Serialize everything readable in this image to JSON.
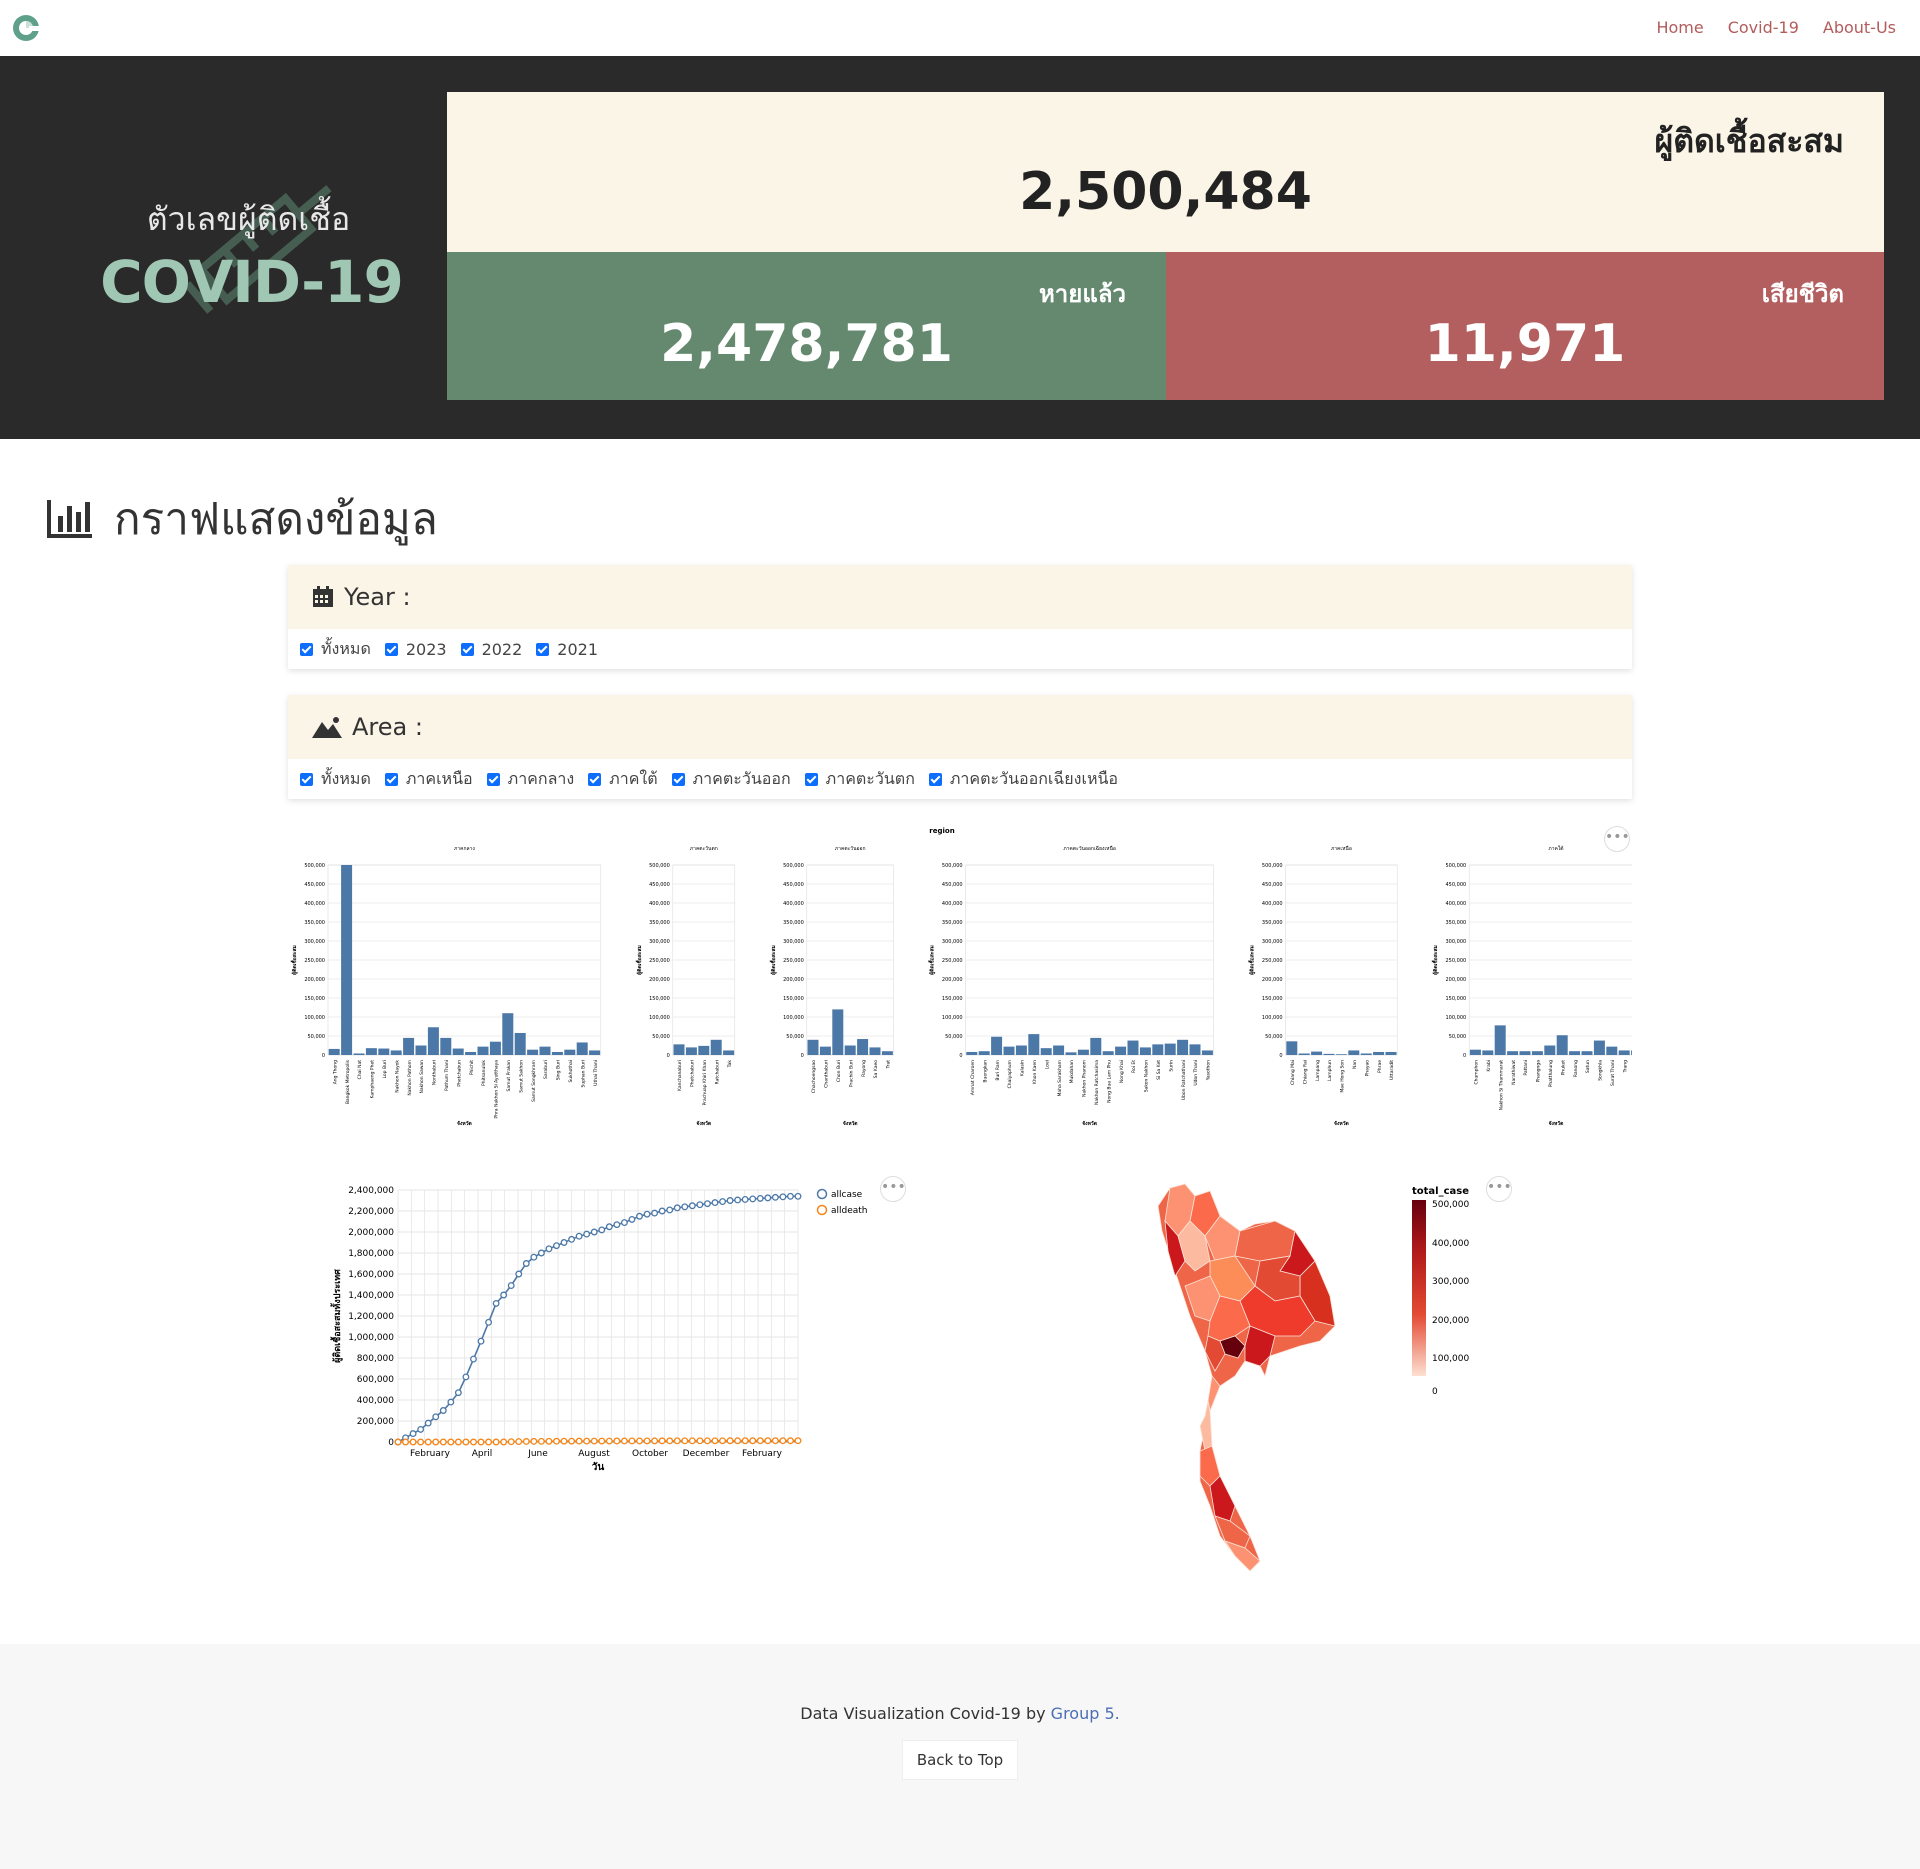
{
  "nav": {
    "links": [
      "Home",
      "Covid-19",
      "About-Us"
    ],
    "accent": "#b35c5c"
  },
  "hero": {
    "subtitle": "ตัวเลขผู้ติดเชื้อ",
    "title": "COVID-19",
    "total_label": "ผู้ติดเชื้อสะสม",
    "total_value": "2,500,484",
    "recovered_label": "หายแล้ว",
    "recovered_value": "2,478,781",
    "death_label": "เสียชีวิต",
    "death_value": "11,971",
    "colors": {
      "total_bg": "#fbf5e8",
      "recovered_bg": "#64896f",
      "death_bg": "#b35f60",
      "hero_bg": "#2a2a2a"
    }
  },
  "section": {
    "title": "กราฟแสดงข้อมูล"
  },
  "year_filter": {
    "label": "Year :",
    "options": [
      "ทั้งหมด",
      "2023",
      "2022",
      "2021"
    ]
  },
  "area_filter": {
    "label": "Area :",
    "options": [
      "ทั้งหมด",
      "ภาคเหนือ",
      "ภาคกลาง",
      "ภาคใต้",
      "ภาคตะวันออก",
      "ภาคตะวันตก",
      "ภาคตะวันออกเฉียงเหนือ"
    ]
  },
  "chart_data": [
    {
      "type": "bar",
      "title": "region",
      "ylabel": "ผู้ติดเชื้อสะสม",
      "xlabel": "จังหวัด",
      "ylim": [
        0,
        500000
      ],
      "yticks": [
        0,
        50000,
        100000,
        150000,
        200000,
        250000,
        300000,
        350000,
        400000,
        450000,
        500000
      ],
      "color": "#4c78a8",
      "facets": [
        {
          "name": "ภาคกลาง",
          "categories": [
            "Ang Thong",
            "Bangkok Metropolis",
            "Chai Nat",
            "Kamphaeng Phet",
            "Lop Buri",
            "Nakhon Nayok",
            "Nakhon Pathom",
            "Nakhon Sawan",
            "Nonthaburi",
            "Pathum Thani",
            "Phetchabun",
            "Phichit",
            "Phitsanulok",
            "Phra Nakhon Si Ayutthaya",
            "Samut Prakan",
            "Samut Sakhon",
            "Samut Songkhram",
            "Saraburi",
            "Sing Buri",
            "Sukhothai",
            "Suphan Buri",
            "Uthai Thani"
          ],
          "values": [
            16000,
            510000,
            4000,
            18000,
            17000,
            12000,
            45000,
            25000,
            73000,
            45000,
            17000,
            8000,
            22000,
            35000,
            110000,
            58000,
            14000,
            22000,
            8000,
            14000,
            33000,
            12000
          ]
        },
        {
          "name": "ภาคตะวันตก",
          "categories": [
            "Kanchanaburi",
            "Phetchaburi",
            "Prachuap Khiri Khan",
            "Ratchaburi",
            "Tak"
          ],
          "values": [
            28000,
            20000,
            24000,
            40000,
            12000
          ]
        },
        {
          "name": "ภาคตะวันออก",
          "categories": [
            "Chachoengsao",
            "Chanthaburi",
            "Chon Buri",
            "Prachin Buri",
            "Rayong",
            "Sa Kaeo",
            "Trat"
          ],
          "values": [
            40000,
            22000,
            120000,
            25000,
            42000,
            20000,
            10000
          ]
        },
        {
          "name": "ภาคตะวันออกเฉียงเหนือ",
          "categories": [
            "Amnat Charoen",
            "Buengkan",
            "Buri Ram",
            "Chaiyaphum",
            "Kalasin",
            "Khon Kaen",
            "Loei",
            "Maha Sarakham",
            "Mukdahan",
            "Nakhon Phanom",
            "Nakhon Ratchasima",
            "Nong Bua Lam Phu",
            "Nong Khai",
            "Roi Et",
            "Sakon Nakhon",
            "Si Sa Ket",
            "Surin",
            "Ubon Ratchathani",
            "Udon Thani",
            "Yasothon"
          ],
          "values": [
            8000,
            10000,
            48000,
            22000,
            25000,
            55000,
            18000,
            25000,
            7000,
            14000,
            45000,
            10000,
            22000,
            38000,
            20000,
            28000,
            30000,
            40000,
            28000,
            12000
          ]
        },
        {
          "name": "ภาคเหนือ",
          "categories": [
            "Chiang Mai",
            "Chiang Rai",
            "Lampang",
            "Lamphun",
            "Mae Hong Son",
            "Nan",
            "Phayao",
            "Phrae",
            "Uttaradit"
          ],
          "values": [
            36000,
            4000,
            9000,
            3000,
            2000,
            12000,
            4000,
            8000,
            8000
          ]
        },
        {
          "name": "ภาคใต้",
          "categories": [
            "Chumphon",
            "Krabi",
            "Nakhon Si Thammarat",
            "Narathiwat",
            "Pattani",
            "Phangnga",
            "Phatthalung",
            "Phuket",
            "Ranong",
            "Satun",
            "Songkhla",
            "Surat Thani",
            "Trang",
            "Yala"
          ],
          "values": [
            14000,
            12000,
            78000,
            10000,
            10000,
            10000,
            25000,
            52000,
            10000,
            10000,
            38000,
            22000,
            12000,
            12000
          ]
        }
      ]
    },
    {
      "type": "line",
      "ylabel": "ผู้ติดเชื้อสะสมทั้งประเทศ",
      "xlabel": "วัน",
      "ylim": [
        0,
        2400000
      ],
      "yticks": [
        0,
        200000,
        400000,
        600000,
        800000,
        1000000,
        1200000,
        1400000,
        1600000,
        1800000,
        2000000,
        2200000,
        2400000
      ],
      "xtick_labels": [
        "February",
        "April",
        "June",
        "August",
        "October",
        "December",
        "February"
      ],
      "legend_position": "top-right",
      "series": [
        {
          "name": "allcase",
          "color": "#4c78a8",
          "values": [
            0,
            40000,
            80000,
            120000,
            180000,
            240000,
            300000,
            380000,
            470000,
            620000,
            790000,
            960000,
            1140000,
            1320000,
            1400000,
            1490000,
            1600000,
            1700000,
            1760000,
            1800000,
            1840000,
            1870000,
            1900000,
            1930000,
            1960000,
            1980000,
            2000000,
            2020000,
            2050000,
            2070000,
            2090000,
            2120000,
            2150000,
            2170000,
            2180000,
            2200000,
            2210000,
            2230000,
            2240000,
            2250000,
            2260000,
            2270000,
            2280000,
            2290000,
            2300000,
            2305000,
            2310000,
            2315000,
            2320000,
            2325000,
            2330000,
            2335000,
            2340000,
            2340000
          ]
        },
        {
          "name": "alldeath",
          "color": "#f58518",
          "values": [
            0,
            0,
            0,
            0,
            0,
            0,
            0,
            0,
            0,
            0,
            0,
            0,
            0,
            0,
            0,
            3000,
            4000,
            5000,
            6000,
            6500,
            7000,
            7500,
            8000,
            8200,
            8500,
            8700,
            9000,
            9200,
            9400,
            9600,
            9800,
            10000,
            10200,
            10400,
            10600,
            10800,
            11000,
            11100,
            11200,
            11300,
            11400,
            11500,
            11600,
            11700,
            11800,
            11850,
            11900,
            11920,
            11940,
            11950,
            11960,
            11965,
            11970,
            11971
          ]
        }
      ]
    }
  ],
  "map": {
    "legend_title": "total_case",
    "legend_ticks": [
      "500,000",
      "400,000",
      "300,000",
      "200,000",
      "100,000",
      "0"
    ],
    "color_low": "#fde0d2",
    "color_high": "#67000d"
  },
  "footer": {
    "credit_prefix": "Data Visualization Covid-19",
    "by": "by",
    "group_link": "Group 5.",
    "back_to_top": "Back to Top"
  }
}
